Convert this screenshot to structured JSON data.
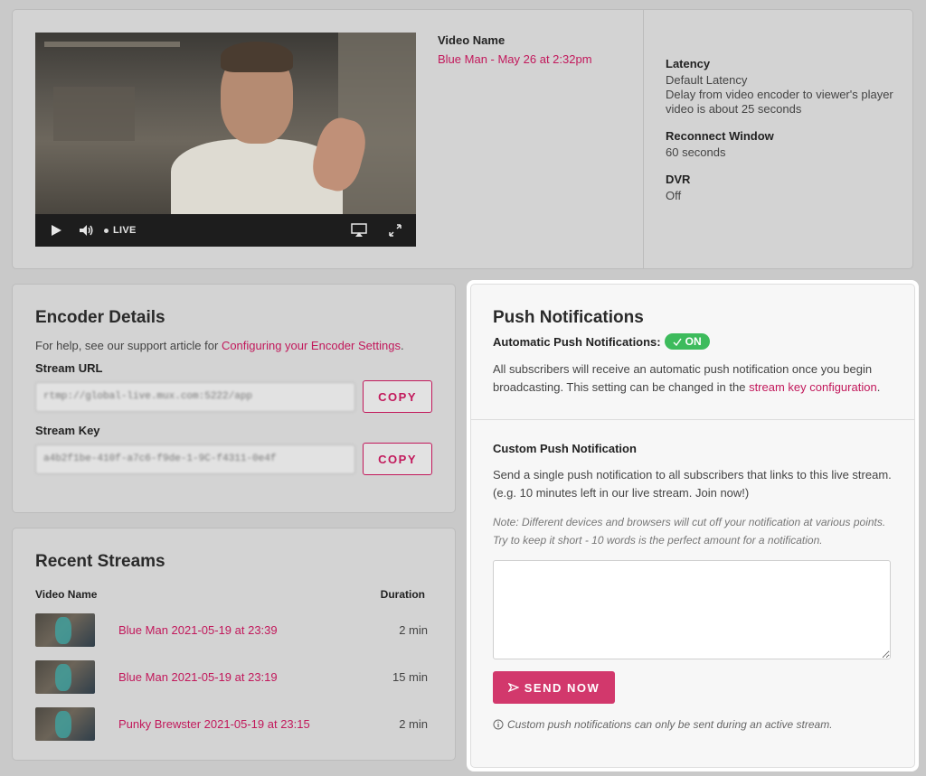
{
  "stream": {
    "video_name_label": "Video Name",
    "video_name": "Blue Man - May 26 at 2:32pm",
    "player": {
      "live_label": "LIVE"
    },
    "settings": [
      {
        "label": "Latency",
        "lines": [
          "Default Latency",
          "Delay from video encoder to viewer's player",
          "video is about 25 seconds"
        ]
      },
      {
        "label": "Reconnect Window",
        "lines": [
          "60 seconds"
        ]
      },
      {
        "label": "DVR",
        "lines": [
          "Off"
        ]
      }
    ]
  },
  "encoder": {
    "title": "Encoder Details",
    "help_prefix": "For help, see our support article for ",
    "help_link": "Configuring your Encoder Settings",
    "help_suffix": ".",
    "stream_url_label": "Stream URL",
    "stream_url_value": "rtmp://global-live.mux.com:5222/app",
    "stream_key_label": "Stream Key",
    "stream_key_value": "a4b2f1be-410f-a7c6-f9de-1-9C-f4311-0e4f",
    "copy_label": "COPY"
  },
  "recent": {
    "title": "Recent Streams",
    "col_name": "Video Name",
    "col_duration": "Duration",
    "rows": [
      {
        "name": "Blue Man 2021-05-19 at 23:39",
        "duration": "2 min"
      },
      {
        "name": "Blue Man 2021-05-19 at 23:19",
        "duration": "15 min"
      },
      {
        "name": "Punky Brewster 2021-05-19 at 23:15",
        "duration": "2 min"
      }
    ]
  },
  "push": {
    "title": "Push Notifications",
    "auto_label": "Automatic Push Notifications:",
    "auto_state": "ON",
    "auto_desc_prefix": "All subscribers will receive an automatic push notification once you begin broadcasting. This setting can be changed in the ",
    "auto_desc_link": "stream key configuration",
    "auto_desc_suffix": ".",
    "custom_title": "Custom Push Notification",
    "custom_desc": "Send a single push notification to all subscribers that links to this live stream. (e.g. 10 minutes left in our live stream. Join now!)",
    "note": "Note: Different devices and browsers will cut off your notification at various points. Try to keep it short - 10 words is the perfect amount for a notification.",
    "textarea_value": "",
    "send_label": "SEND NOW",
    "info": "Custom push notifications can only be sent during an active stream."
  },
  "colors": {
    "accent": "#c2185b",
    "button": "#d2386c",
    "on_pill": "#3dbb5c"
  }
}
